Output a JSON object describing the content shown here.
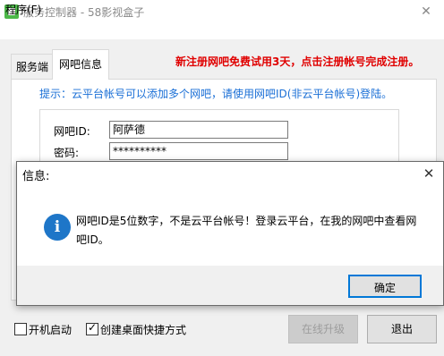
{
  "window": {
    "title": "服务控制器 - 58影视盒子",
    "close_glyph": "✕"
  },
  "menu": {
    "program": "程序(F)"
  },
  "tabs": [
    {
      "label": "服务端"
    },
    {
      "label": "网吧信息"
    }
  ],
  "promo_text": "新注册网吧免费试用3天，点击注册帐号完成注册。",
  "panel": {
    "hint": "提示：云平台帐号可以添加多个网吧，请使用网吧ID(非云平台帐号)登陆。",
    "netbar_id_label": "网吧ID:",
    "netbar_id_value": "阿萨德",
    "password_label": "密码:",
    "password_value": "**********"
  },
  "bottom": {
    "startup_label": "开机启动",
    "startup_checked": false,
    "shortcut_label": "创建桌面快捷方式",
    "shortcut_checked": true,
    "upgrade_label": "在线升级",
    "exit_label": "退出"
  },
  "dialog": {
    "title": "信息:",
    "message": "网吧ID是5位数字，不是云平台帐号！登录云平台，在我的网吧中查看网吧ID。",
    "ok_label": "确定",
    "close_glyph": "✕",
    "icon": "info-icon",
    "icon_glyph": "i"
  },
  "colors": {
    "promo": "#e00000",
    "hint": "#1a6fd6",
    "info_icon": "#1e76c8",
    "focus_border": "#0078d7"
  }
}
